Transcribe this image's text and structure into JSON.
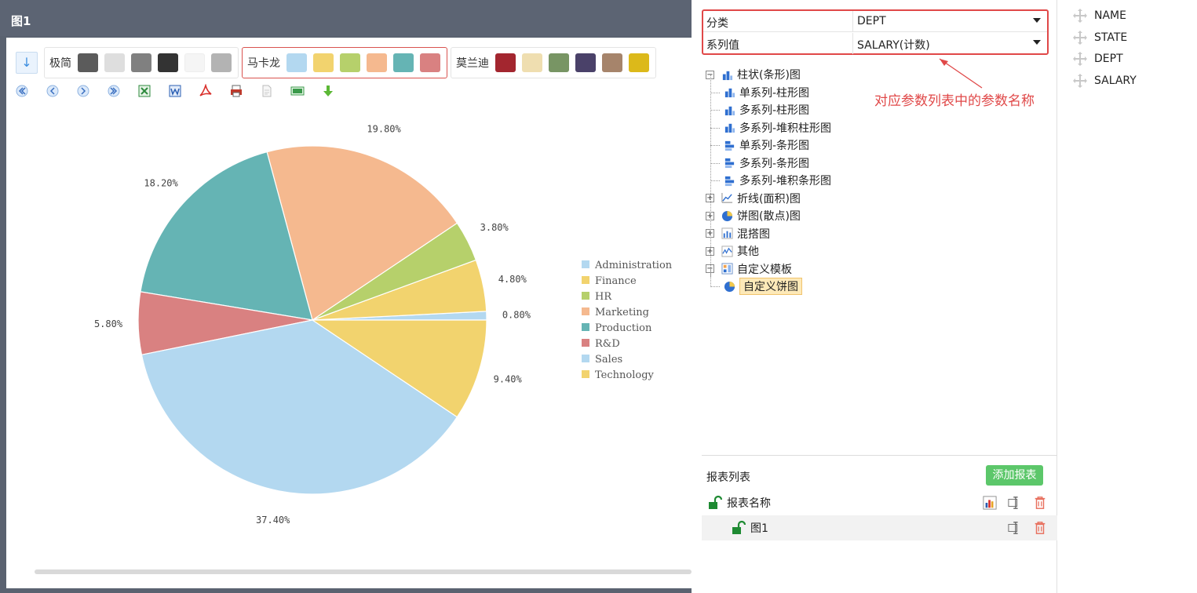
{
  "chart_window": {
    "title": "图1"
  },
  "palette_bar": {
    "sort_icon": "arrow-down-icon",
    "groups": [
      {
        "label": "极简",
        "colors": [
          "#5b5b5b",
          "#dedede",
          "#808080",
          "#333333",
          "#f5f5f5",
          "#b3b3b3"
        ]
      },
      {
        "label": "马卡龙",
        "colors": [
          "#b3d8f0",
          "#f2d36e",
          "#b6d06b",
          "#f5b98f",
          "#65b4b4",
          "#d98181"
        ]
      },
      {
        "label": "莫兰迪",
        "colors": [
          "#a3262f",
          "#efdeb0",
          "#789564",
          "#4a4169",
          "#a6846b",
          "#dcb91a"
        ]
      }
    ]
  },
  "export_toolbar": {
    "icons": [
      "first-page-icon",
      "previous-page-icon",
      "next-page-icon",
      "last-page-icon",
      "export-excel-icon",
      "export-word-icon",
      "export-pdf-icon",
      "print-icon",
      "export-text-icon",
      "export-csv-icon",
      "download-icon"
    ]
  },
  "chart_data": {
    "type": "pie",
    "categories": [
      "Administration",
      "Finance",
      "HR",
      "Marketing",
      "Production",
      "R&D",
      "Sales",
      "Technology"
    ],
    "values": [
      0.8,
      4.8,
      3.8,
      19.8,
      18.2,
      5.8,
      37.4,
      9.4
    ],
    "labels": [
      "0.80%",
      "4.80%",
      "3.80%",
      "19.80%",
      "18.20%",
      "5.80%",
      "37.40%",
      "9.40%"
    ],
    "colors": [
      "#b3d8f0",
      "#f2d36e",
      "#b6d06b",
      "#f5b98f",
      "#65b4b4",
      "#d98181",
      "#b3d8f0",
      "#f2d36e"
    ],
    "legend_position": "right",
    "title": ""
  },
  "config_panel": {
    "params": [
      {
        "key": "分类",
        "value": "DEPT"
      },
      {
        "key": "系列值",
        "value": "SALARY(计数)"
      }
    ],
    "annotation": "对应参数列表中的参数名称",
    "tree": [
      {
        "label": "柱状(条形)图",
        "level": 0,
        "expander": "−",
        "icon": "bar-chart-icon"
      },
      {
        "label": "单系列-柱形图",
        "level": 1,
        "icon": "column-chart-icon"
      },
      {
        "label": "多系列-柱形图",
        "level": 1,
        "icon": "column-chart-icon"
      },
      {
        "label": "多系列-堆积柱形图",
        "level": 1,
        "icon": "column-chart-icon"
      },
      {
        "label": "单系列-条形图",
        "level": 1,
        "icon": "horizontal-bar-icon"
      },
      {
        "label": "多系列-条形图",
        "level": 1,
        "icon": "horizontal-bar-icon"
      },
      {
        "label": "多系列-堆积条形图",
        "level": 1,
        "icon": "horizontal-bar-icon"
      },
      {
        "label": "折线(面积)图",
        "level": 0,
        "expander": "+",
        "icon": "line-chart-icon"
      },
      {
        "label": "饼图(散点)图",
        "level": 0,
        "expander": "+",
        "icon": "pie-chart-icon"
      },
      {
        "label": "混搭图",
        "level": 0,
        "expander": "+",
        "icon": "mixed-chart-icon"
      },
      {
        "label": "其他",
        "level": 0,
        "expander": "+",
        "icon": "other-chart-icon"
      },
      {
        "label": "自定义模板",
        "level": 0,
        "expander": "−",
        "icon": "template-icon"
      },
      {
        "label": "自定义饼图",
        "level": 1,
        "icon": "pie-chart-icon",
        "selected": true
      }
    ],
    "report_list": {
      "title": "报表列表",
      "add_button": "添加报表",
      "header_row": "报表名称",
      "items": [
        {
          "name": "图1"
        }
      ]
    }
  },
  "field_list": {
    "fields": [
      "NAME",
      "STATE",
      "DEPT",
      "SALARY"
    ]
  }
}
